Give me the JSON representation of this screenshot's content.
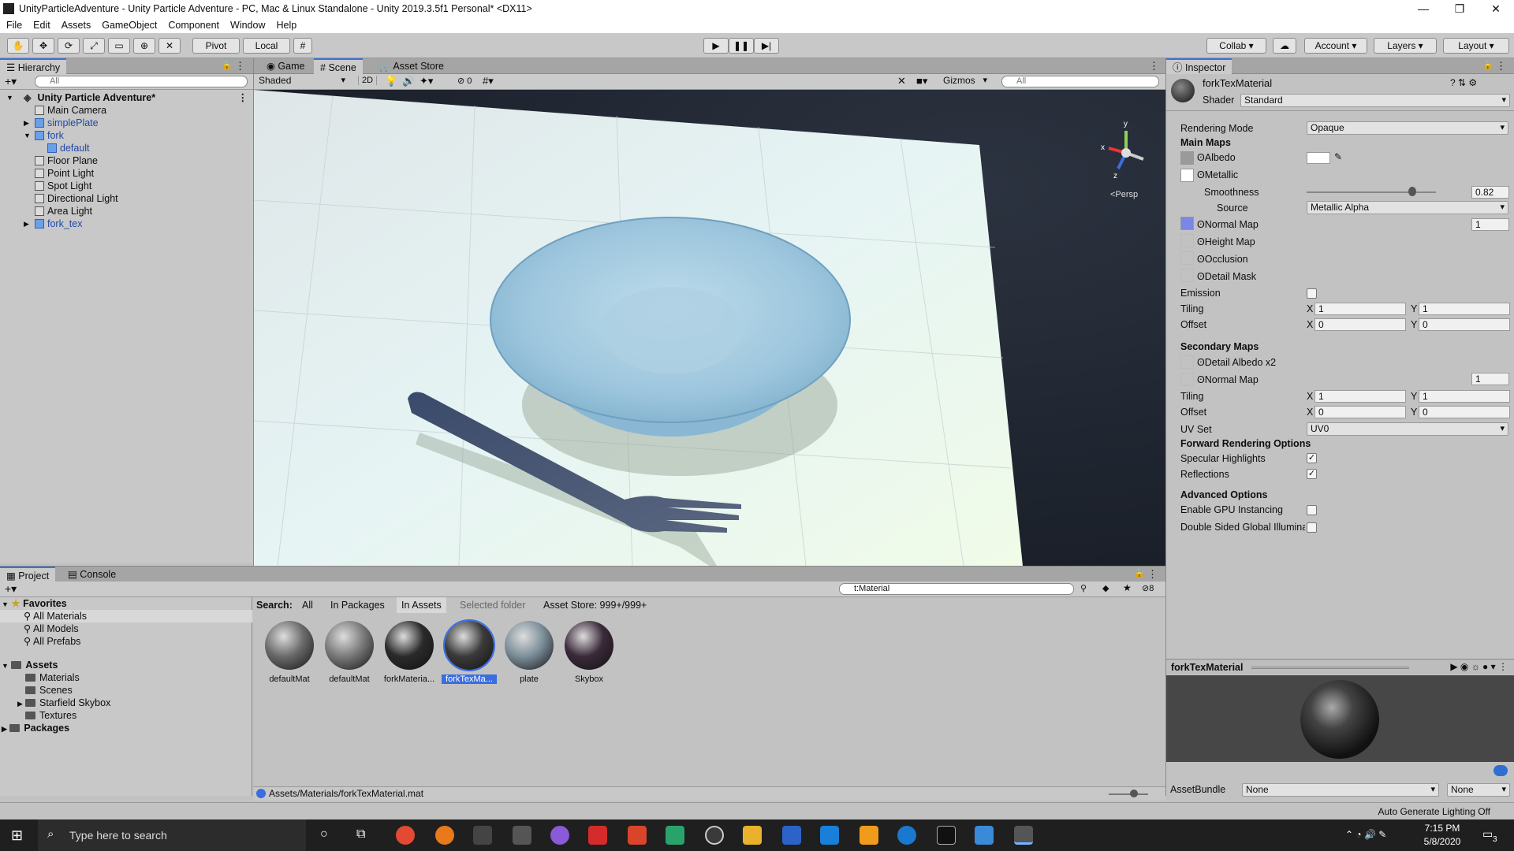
{
  "window": {
    "title": "UnityParticleAdventure - Unity Particle Adventure - PC, Mac & Linux Standalone - Unity 2019.3.5f1 Personal* <DX11>",
    "controls": [
      "—",
      "❐",
      "✕"
    ]
  },
  "menu": [
    "File",
    "Edit",
    "Assets",
    "GameObject",
    "Component",
    "Window",
    "Help"
  ],
  "toolbar": {
    "pivot": "Pivot",
    "local": "Local",
    "collab": "Collab",
    "account": "Account",
    "layers": "Layers",
    "layout": "Layout"
  },
  "hierarchy": {
    "tab": "Hierarchy",
    "search_placeholder": "All",
    "scene": "Unity Particle Adventure*",
    "items": [
      {
        "label": "Main Camera",
        "indent": 1,
        "blue": false,
        "expand": ""
      },
      {
        "label": "simplePlate",
        "indent": 1,
        "blue": true,
        "expand": "▶"
      },
      {
        "label": "fork",
        "indent": 1,
        "blue": true,
        "expand": "▼"
      },
      {
        "label": "default",
        "indent": 2,
        "blue": true,
        "expand": ""
      },
      {
        "label": "Floor Plane",
        "indent": 1,
        "blue": false,
        "expand": ""
      },
      {
        "label": "Point Light",
        "indent": 1,
        "blue": false,
        "expand": ""
      },
      {
        "label": "Spot Light",
        "indent": 1,
        "blue": false,
        "expand": ""
      },
      {
        "label": "Directional Light",
        "indent": 1,
        "blue": false,
        "expand": ""
      },
      {
        "label": "Area Light",
        "indent": 1,
        "blue": false,
        "expand": ""
      },
      {
        "label": "fork_tex",
        "indent": 1,
        "blue": true,
        "expand": "▶"
      }
    ]
  },
  "scene_view": {
    "tabs": [
      "Game",
      "Scene",
      "Asset Store"
    ],
    "shading": "Shaded",
    "mode_2d": "2D",
    "hidden_count": "0",
    "gizmos": "Gizmos",
    "search_placeholder": "All",
    "persp": "<Persp",
    "axes": {
      "x": "x",
      "y": "y",
      "z": "z"
    }
  },
  "inspector": {
    "tab": "Inspector",
    "material_name": "forkTexMaterial",
    "shader_label": "Shader",
    "shader_value": "Standard",
    "rendering_mode_label": "Rendering Mode",
    "rendering_mode": "Opaque",
    "main_maps": "Main Maps",
    "albedo": "Albedo",
    "metallic": "Metallic",
    "smoothness": "Smoothness",
    "smoothness_value": "0.82",
    "smoothness_fraction": 0.82,
    "source": "Source",
    "source_value": "Metallic Alpha",
    "normal_map": "Normal Map",
    "normal_scale": "1",
    "height_map": "Height Map",
    "occlusion": "Occlusion",
    "detail_mask": "Detail Mask",
    "emission": "Emission",
    "tiling": "Tiling",
    "offset": "Offset",
    "x": "X",
    "y": "Y",
    "tiling_x": "1",
    "tiling_y": "1",
    "offset_x": "0",
    "offset_y": "0",
    "secondary_maps": "Secondary Maps",
    "detail_albedo": "Detail Albedo x2",
    "sec_normal_map": "Normal Map",
    "sec_normal_scale": "1",
    "sec_tiling_x": "1",
    "sec_tiling_y": "1",
    "sec_offset_x": "0",
    "sec_offset_y": "0",
    "uv_set_label": "UV Set",
    "uv_set": "UV0",
    "forward_options": "Forward Rendering Options",
    "specular_highlights": "Specular Highlights",
    "reflections": "Reflections",
    "advanced_options": "Advanced Options",
    "gpu_instancing": "Enable GPU Instancing",
    "double_sided": "Double Sided Global Illumina",
    "preview_title": "forkTexMaterial",
    "assetbundle_label": "AssetBundle",
    "assetbundle_value": "None",
    "assetbundle_variant": "None"
  },
  "project": {
    "tabs": [
      "Project",
      "Console"
    ],
    "search_value": "t:Material",
    "hidden_count": "8",
    "favorites": "Favorites",
    "fav_items": [
      "All Materials",
      "All Models",
      "All Prefabs"
    ],
    "assets": "Assets",
    "asset_folders": [
      {
        "label": "Materials",
        "expand": ""
      },
      {
        "label": "Scenes",
        "expand": ""
      },
      {
        "label": "Starfield Skybox",
        "expand": "▶"
      },
      {
        "label": "Textures",
        "expand": ""
      }
    ],
    "packages": "Packages",
    "search_label": "Search:",
    "filters": [
      "All",
      "In Packages",
      "In Assets",
      "Selected folder"
    ],
    "asset_store": "Asset Store: 999+/999+",
    "items": [
      {
        "label": "defaultMat",
        "color": "#6a6a6a"
      },
      {
        "label": "defaultMat",
        "color": "#7a7a7a"
      },
      {
        "label": "forkMateria...",
        "color": "#2a2a2a"
      },
      {
        "label": "forkTexMa...",
        "color": "#3a3a3a"
      },
      {
        "label": "plate",
        "color": "#7c8e99"
      },
      {
        "label": "Skybox",
        "color": "#3a2a3a"
      }
    ],
    "path": "Assets/Materials/forkTexMaterial.mat"
  },
  "status": {
    "lighting": "Auto Generate Lighting Off"
  },
  "taskbar": {
    "search_placeholder": "Type here to search",
    "time": "7:15 PM",
    "date": "5/8/2020",
    "notifications": "3"
  }
}
